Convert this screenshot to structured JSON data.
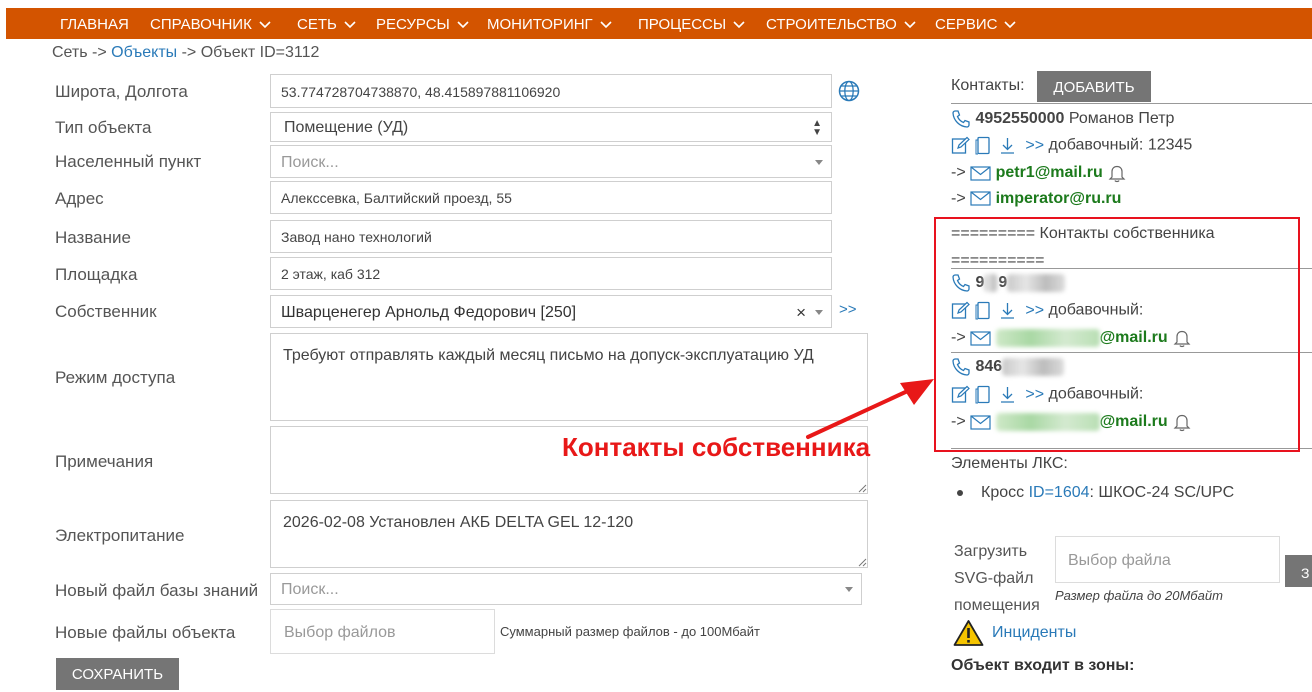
{
  "nav": {
    "items": [
      {
        "label": "ГЛАВНАЯ",
        "dropdown": false
      },
      {
        "label": "СПРАВОЧНИК",
        "dropdown": true
      },
      {
        "label": "СЕТЬ",
        "dropdown": true
      },
      {
        "label": "РЕСУРСЫ",
        "dropdown": true
      },
      {
        "label": "МОНИТОРИНГ",
        "dropdown": true
      },
      {
        "label": "ПРОЦЕССЫ",
        "dropdown": true
      },
      {
        "label": "СТРОИТЕЛЬСТВО",
        "dropdown": true
      },
      {
        "label": "СЕРВИС",
        "dropdown": true
      }
    ],
    "bg_color": "#d35400"
  },
  "breadcrumb": {
    "root": "Сеть",
    "sep": " -> ",
    "link": "Объекты",
    "current": "Объект ID=3112"
  },
  "form": {
    "coords": {
      "label": "Широта, Долгота",
      "value": "53.774728704738870, 48.415897881106920"
    },
    "type": {
      "label": "Тип объекта",
      "value": "Помещение (УД)"
    },
    "locality": {
      "label": "Населенный пункт",
      "placeholder": "Поиск..."
    },
    "address": {
      "label": "Адрес",
      "value": "Алекссевка, Балтийский проезд, 55"
    },
    "name": {
      "label": "Название",
      "value": "Завод нано технологий"
    },
    "site": {
      "label": "Площадка",
      "value": "2 этаж, каб 312"
    },
    "owner": {
      "label": "Собственник",
      "value": "Шварценегер Арнольд Федорович [250]",
      "clear": "×",
      "more": ">>"
    },
    "access": {
      "label": "Режим доступа",
      "value": "Требуют отправлять каждый месяц письмо на допуск-эксплуатацию УД"
    },
    "notes": {
      "label": "Примечания",
      "value": ""
    },
    "power": {
      "label": "Электропитание",
      "value": "2026-02-08 Установлен АКБ DELTA GEL 12-120"
    },
    "kb_file": {
      "label": "Новый файл базы знаний",
      "placeholder": "Поиск..."
    },
    "obj_files": {
      "label": "Новые файлы объекта",
      "button": "Выбор файлов",
      "hint": "Суммарный размер файлов - до 100Мбайт"
    },
    "save": "СОХРАНИТЬ"
  },
  "contacts": {
    "label": "Контакты:",
    "add": "ДОБАВИТЬ",
    "primary": {
      "phone": "4952550000",
      "person": "Романов Петр",
      "arrows": ">>",
      "ext_label": "добавочный:",
      "ext": "12345",
      "arrow_prefix": "->",
      "emails": [
        "petr1@mail.ru",
        "imperator@ru.ru"
      ]
    },
    "owner_header": "========= Контакты собственника ==========",
    "owner_items": [
      {
        "phone_prefix": "9",
        "phone_mid": "9",
        "ext_label": "добавочный:",
        "email_suffix": "@mail.ru"
      },
      {
        "phone_prefix": "846",
        "ext_label": "добавочный:",
        "email_suffix": "@mail.ru"
      }
    ]
  },
  "annotation": "Контакты собственника",
  "lks": {
    "label": "Элементы ЛКС:",
    "item_prefix": "Кросс",
    "item_link": "ID=1604",
    "item_suffix": ": ШКОС-24 SC/UPC"
  },
  "svg_upload": {
    "label_l1": "Загрузить",
    "label_l2": "SVG-файл",
    "label_l3": "помещения",
    "button": "Выбор файла",
    "hint": "Размер файла до 20Мбайт",
    "cut_btn": "З"
  },
  "incidents": "Инциденты",
  "zones": "Объект входит в зоны:"
}
